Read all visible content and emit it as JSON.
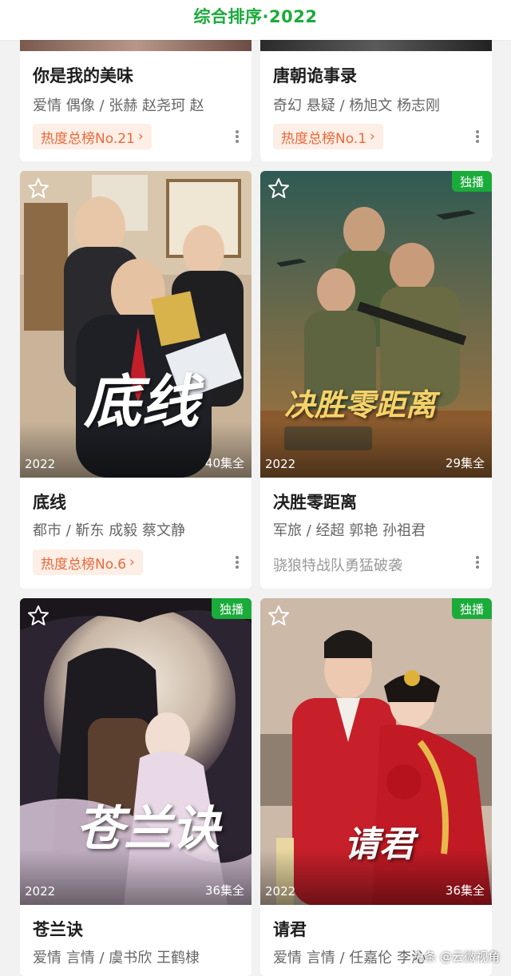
{
  "header": {
    "title": "综合排序·2022"
  },
  "cards": [
    {
      "title": "你是我的美味",
      "meta": "爱情 偶像 / 张赫 赵尧珂 赵",
      "rank": "热度总榜No.21",
      "rank_chevron": "›"
    },
    {
      "title": "唐朝诡事录",
      "meta": "奇幻 悬疑 / 杨旭文 杨志刚",
      "rank": "热度总榜No.1",
      "rank_chevron": "›"
    },
    {
      "title": "底线",
      "meta": "都市 / 靳东 成毅 蔡文静",
      "rank": "热度总榜No.6",
      "rank_chevron": "›",
      "year": "2022",
      "episodes": "40集全",
      "poster_text": "底线"
    },
    {
      "title": "决胜零距离",
      "meta": "军旅 / 经超 郭艳 孙祖君",
      "tagline": "骁狼特战队勇猛破袭",
      "year": "2022",
      "episodes": "29集全",
      "badge": "独播",
      "poster_text": "决胜零距离"
    },
    {
      "title": "苍兰诀",
      "meta": "爱情 言情 / 虞书欣 王鹤棣",
      "year": "2022",
      "episodes": "36集全",
      "badge": "独播",
      "poster_text": "苍兰诀"
    },
    {
      "title": "请君",
      "meta": "爱情 言情 / 任嘉伦 李沁",
      "year": "2022",
      "episodes": "36集全",
      "badge": "独播",
      "poster_text": "请君"
    }
  ],
  "icons": {
    "favorite": "star-outline-icon",
    "more": "more-vertical-icon"
  },
  "watermark": "头条 @云微视角",
  "colors": {
    "accent": "#1aab3a",
    "rank_text": "#e8693a",
    "rank_bg": "#fdeee6"
  }
}
